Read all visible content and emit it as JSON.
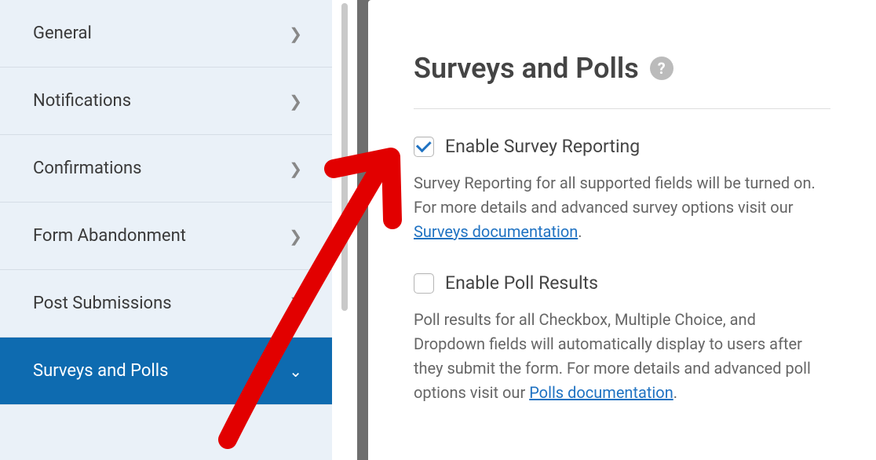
{
  "sidebar": {
    "items": [
      {
        "label": "General",
        "active": false
      },
      {
        "label": "Notifications",
        "active": false
      },
      {
        "label": "Confirmations",
        "active": false
      },
      {
        "label": "Form Abandonment",
        "active": false
      },
      {
        "label": "Post Submissions",
        "active": false
      },
      {
        "label": "Surveys and Polls",
        "active": true
      }
    ]
  },
  "panel": {
    "title": "Surveys and Polls",
    "options": [
      {
        "checked": true,
        "label": "Enable Survey Reporting",
        "desc_before": "Survey Reporting for all supported fields will be turned on. For more details and advanced survey options visit our ",
        "link_text": "Surveys documentation",
        "desc_after": "."
      },
      {
        "checked": false,
        "label": "Enable Poll Results",
        "desc_before": "Poll results for all Checkbox, Multiple Choice, and Dropdown fields will automatically display to users after they submit the form. For more details and advanced poll options visit our ",
        "link_text": "Polls documentation",
        "desc_after": "."
      }
    ]
  }
}
